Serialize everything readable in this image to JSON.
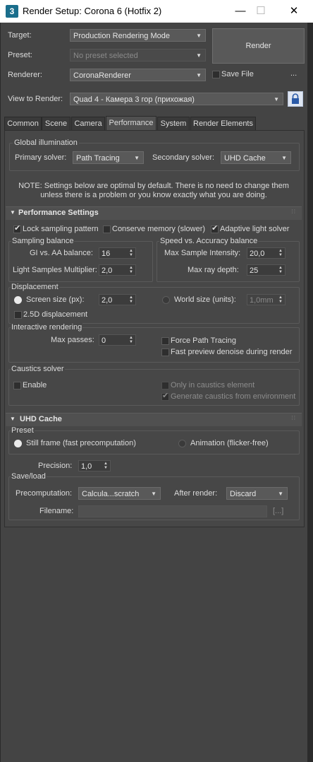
{
  "window": {
    "title": "Render Setup: Corona 6 (Hotfix 2)",
    "app_icon": "3",
    "minimize": "—",
    "maximize": "☐",
    "close": "✕"
  },
  "header": {
    "target_label": "Target:",
    "target_value": "Production Rendering Mode",
    "preset_label": "Preset:",
    "preset_value": "No preset selected",
    "renderer_label": "Renderer:",
    "renderer_value": "CoronaRenderer",
    "save_file_label": "Save File",
    "more_label": "...",
    "view_label": "View to Render:",
    "view_value": "Quad 4 - Камера 3 гор (прихожая)",
    "render_button": "Render"
  },
  "tabs": [
    {
      "label": "Common"
    },
    {
      "label": "Scene"
    },
    {
      "label": "Camera"
    },
    {
      "label": "Performance"
    },
    {
      "label": "System"
    },
    {
      "label": "Render Elements"
    }
  ],
  "global_illumination": {
    "title": "Global illumination",
    "primary_label": "Primary solver:",
    "primary_value": "Path Tracing",
    "secondary_label": "Secondary solver:",
    "secondary_value": "UHD Cache",
    "note_line1": "NOTE: Settings below are optimal by default. There is no need to change them",
    "note_line2": "unless there is a problem or you know exactly what you are doing."
  },
  "performance": {
    "title": "Performance Settings",
    "lock_sampling": "Lock sampling pattern",
    "conserve_memory": "Conserve memory (slower)",
    "adaptive_light": "Adaptive light solver",
    "sampling_balance": {
      "title": "Sampling balance",
      "gi_aa_label": "GI vs. AA balance:",
      "gi_aa_value": "16",
      "light_mult_label": "Light Samples Multiplier:",
      "light_mult_value": "2,0"
    },
    "speed_accuracy": {
      "title": "Speed vs. Accuracy balance",
      "max_intensity_label": "Max Sample Intensity:",
      "max_intensity_value": "20,0",
      "max_depth_label": "Max ray depth:",
      "max_depth_value": "25"
    },
    "displacement": {
      "title": "Displacement",
      "screen_size_label": "Screen size (px):",
      "screen_size_value": "2,0",
      "world_size_label": "World size (units):",
      "world_size_value": "1,0mm",
      "twofive_label": "2.5D displacement"
    },
    "interactive": {
      "title": "Interactive rendering",
      "max_passes_label": "Max passes:",
      "max_passes_value": "0",
      "force_path_label": "Force Path Tracing",
      "fast_denoise_label": "Fast preview denoise during render"
    },
    "caustics": {
      "title": "Caustics solver",
      "enable_label": "Enable",
      "only_caustics_label": "Only in caustics element",
      "generate_env_label": "Generate caustics from environment"
    }
  },
  "uhd_cache": {
    "title": "UHD Cache",
    "preset_title": "Preset",
    "still_frame_label": "Still frame (fast precomputation)",
    "animation_label": "Animation (flicker-free)",
    "precision_label": "Precision:",
    "precision_value": "1,0",
    "saveload_title": "Save/load",
    "precomputation_label": "Precomputation:",
    "precomputation_value": "Calcula...scratch",
    "after_render_label": "After render:",
    "after_render_value": "Discard",
    "filename_label": "Filename:",
    "browse_label": "[...]"
  },
  "icons": {
    "dropdown": "▼",
    "spinner": "▲▼",
    "rollout_open": "▼",
    "lock": "lock-icon"
  }
}
